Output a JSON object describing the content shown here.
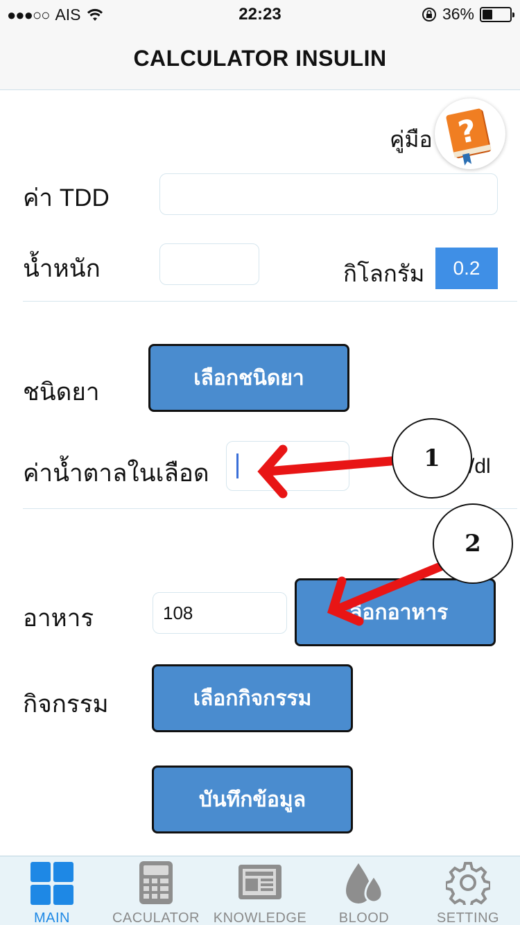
{
  "status": {
    "signal": "●●●○○",
    "carrier": "AIS",
    "time": "22:23",
    "battery": "36%",
    "battery_level": 0.36
  },
  "nav": {
    "title": "CALCULATOR INSULIN"
  },
  "manual": {
    "label": "คู่มือ"
  },
  "form": {
    "tdd_label": "ค่า TDD",
    "tdd_value": "",
    "weight_label": "น้ำหนัก",
    "weight_value": "",
    "weight_unit": "กิโลกรัม",
    "factor": "0.2",
    "drug_label": "ชนิดยา",
    "drug_button": "เลือกชนิดยา",
    "sugar_label": "ค่าน้ำตาลในเลือด",
    "sugar_unit": "/dl",
    "food_label": "อาหาร",
    "food_value": "108",
    "food_button": "เลือกอาหาร",
    "activity_label": "กิจกรรม",
    "activity_button": "เลือกกิจกรรม",
    "save_button": "บันทึกข้อมูล"
  },
  "annotations": [
    {
      "number": "1",
      "color": "#e81515"
    },
    {
      "number": "2",
      "color": "#e81515"
    }
  ],
  "tabs": [
    {
      "label": "MAIN",
      "icon": "grid-icon",
      "active": true
    },
    {
      "label": "CACULATOR",
      "icon": "calculator-icon",
      "active": false
    },
    {
      "label": "KNOWLEDGE",
      "icon": "newspaper-icon",
      "active": false
    },
    {
      "label": "BLOOD",
      "icon": "blood-drops-icon",
      "active": false
    },
    {
      "label": "SETTING",
      "icon": "gear-icon",
      "active": false
    }
  ],
  "colors": {
    "accent": "#4a8ccf",
    "tab_active": "#1e88e5",
    "arrow": "#e81515"
  }
}
